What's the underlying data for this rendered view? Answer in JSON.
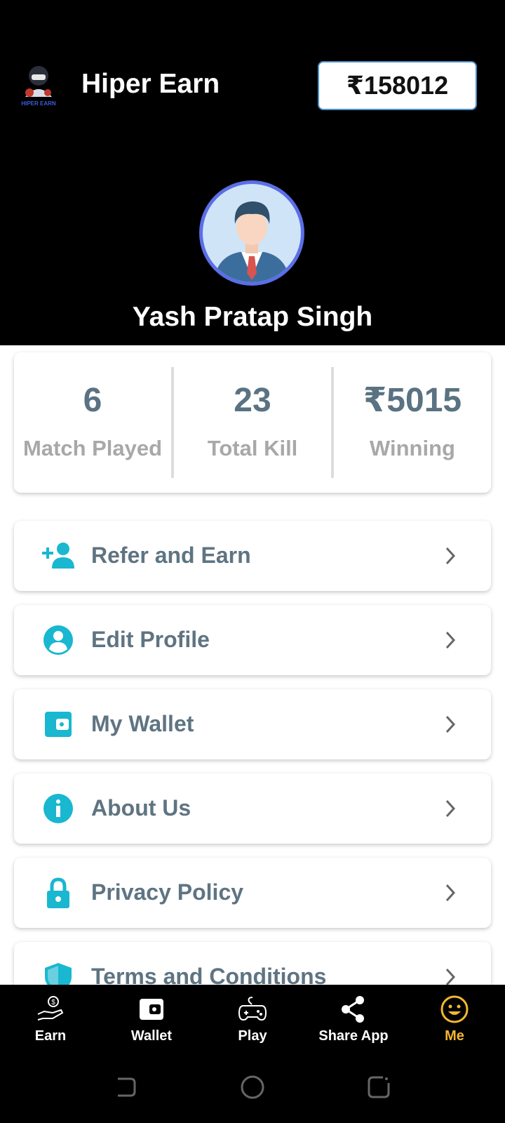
{
  "header": {
    "logo_text": "HIPER EARN",
    "app_title": "Hiper Earn",
    "balance": "₹158012"
  },
  "profile": {
    "name": "Yash Pratap Singh"
  },
  "stats": [
    {
      "value": "6",
      "label": "Match Played"
    },
    {
      "value": "23",
      "label": "Total Kill"
    },
    {
      "value": "₹5015",
      "label": "Winning"
    }
  ],
  "menu": [
    {
      "label": "Refer and Earn",
      "icon": "add-person-icon"
    },
    {
      "label": "Edit Profile",
      "icon": "account-circle-icon"
    },
    {
      "label": "My Wallet",
      "icon": "wallet-icon"
    },
    {
      "label": "About Us",
      "icon": "info-icon"
    },
    {
      "label": "Privacy Policy",
      "icon": "lock-icon"
    },
    {
      "label": "Terms and Conditions",
      "icon": "shield-icon"
    }
  ],
  "nav": [
    {
      "label": "Earn",
      "icon": "earn-hand-icon"
    },
    {
      "label": "Wallet",
      "icon": "wallet-icon"
    },
    {
      "label": "Play",
      "icon": "gamepad-icon"
    },
    {
      "label": "Share App",
      "icon": "share-icon"
    },
    {
      "label": "Me",
      "icon": "smiley-icon",
      "active": true
    }
  ],
  "colors": {
    "accent": "#19b7d0",
    "active_nav": "#f5b731",
    "menu_text": "#5f7482"
  }
}
